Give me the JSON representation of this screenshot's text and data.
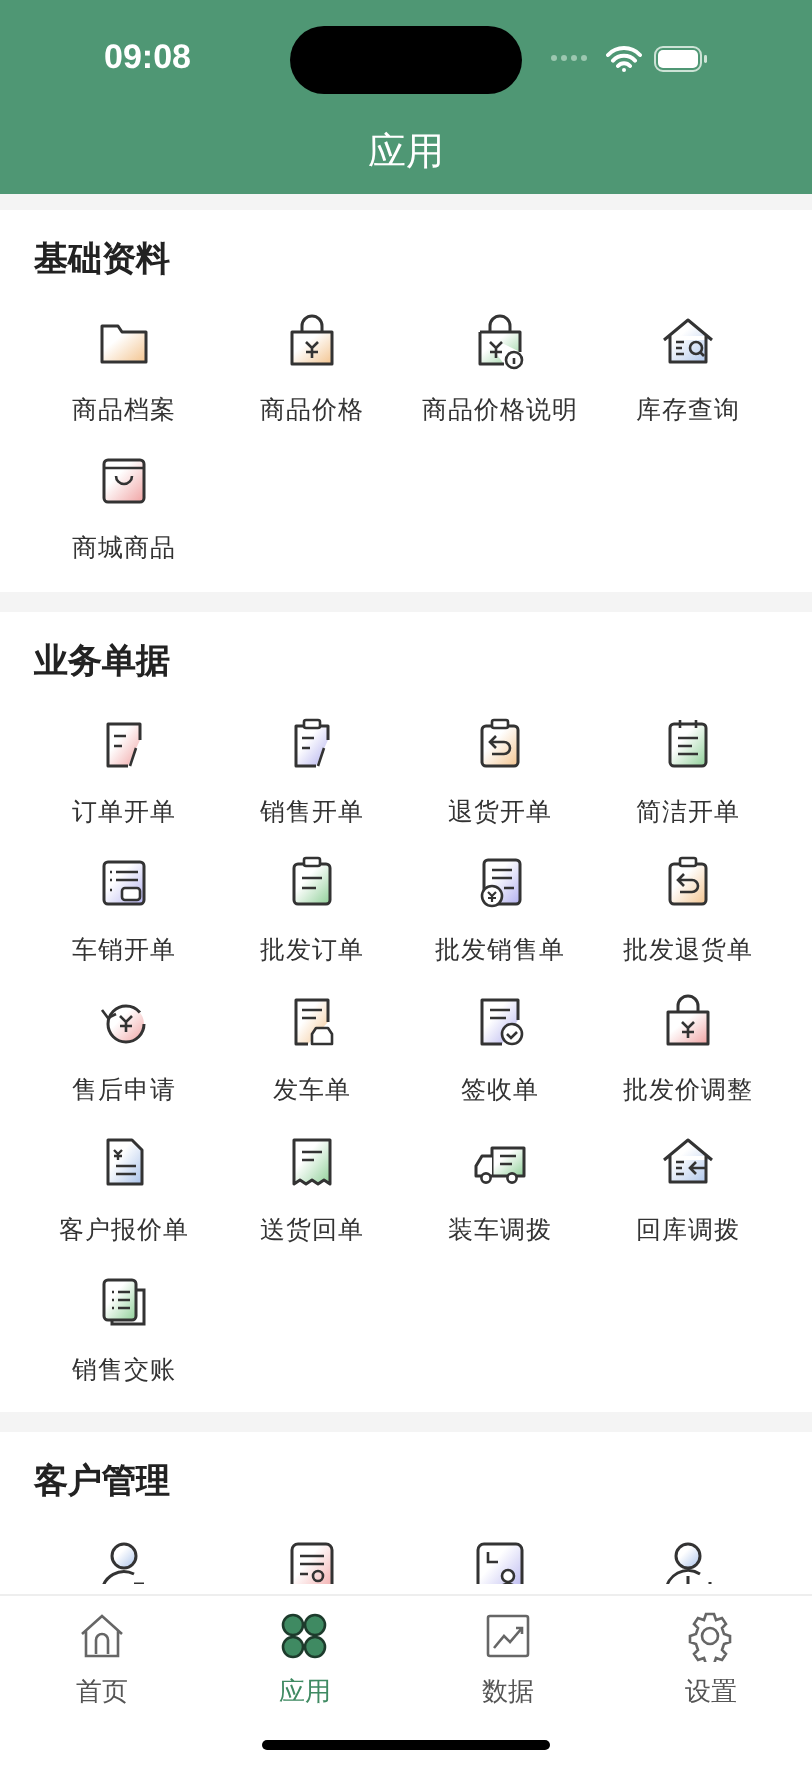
{
  "status_bar": {
    "time": "09:08"
  },
  "header": {
    "title": "应用"
  },
  "sections": [
    {
      "title": "基础资料",
      "items": [
        {
          "label": "商品档案"
        },
        {
          "label": "商品价格"
        },
        {
          "label": "商品价格说明"
        },
        {
          "label": "库存查询"
        },
        {
          "label": "商城商品"
        }
      ]
    },
    {
      "title": "业务单据",
      "items": [
        {
          "label": "订单开单"
        },
        {
          "label": "销售开单"
        },
        {
          "label": "退货开单"
        },
        {
          "label": "简洁开单"
        },
        {
          "label": "车销开单"
        },
        {
          "label": "批发订单"
        },
        {
          "label": "批发销售单"
        },
        {
          "label": "批发退货单"
        },
        {
          "label": "售后申请"
        },
        {
          "label": "发车单"
        },
        {
          "label": "签收单"
        },
        {
          "label": "批发价调整"
        },
        {
          "label": "客户报价单"
        },
        {
          "label": "送货回单"
        },
        {
          "label": "装车调拨"
        },
        {
          "label": "回库调拨"
        },
        {
          "label": "销售交账"
        }
      ]
    },
    {
      "title": "客户管理"
    }
  ],
  "tab_bar": [
    {
      "label": "首页",
      "selected": false
    },
    {
      "label": "应用",
      "selected": true
    },
    {
      "label": "数据",
      "selected": false
    },
    {
      "label": "设置",
      "selected": false
    }
  ]
}
